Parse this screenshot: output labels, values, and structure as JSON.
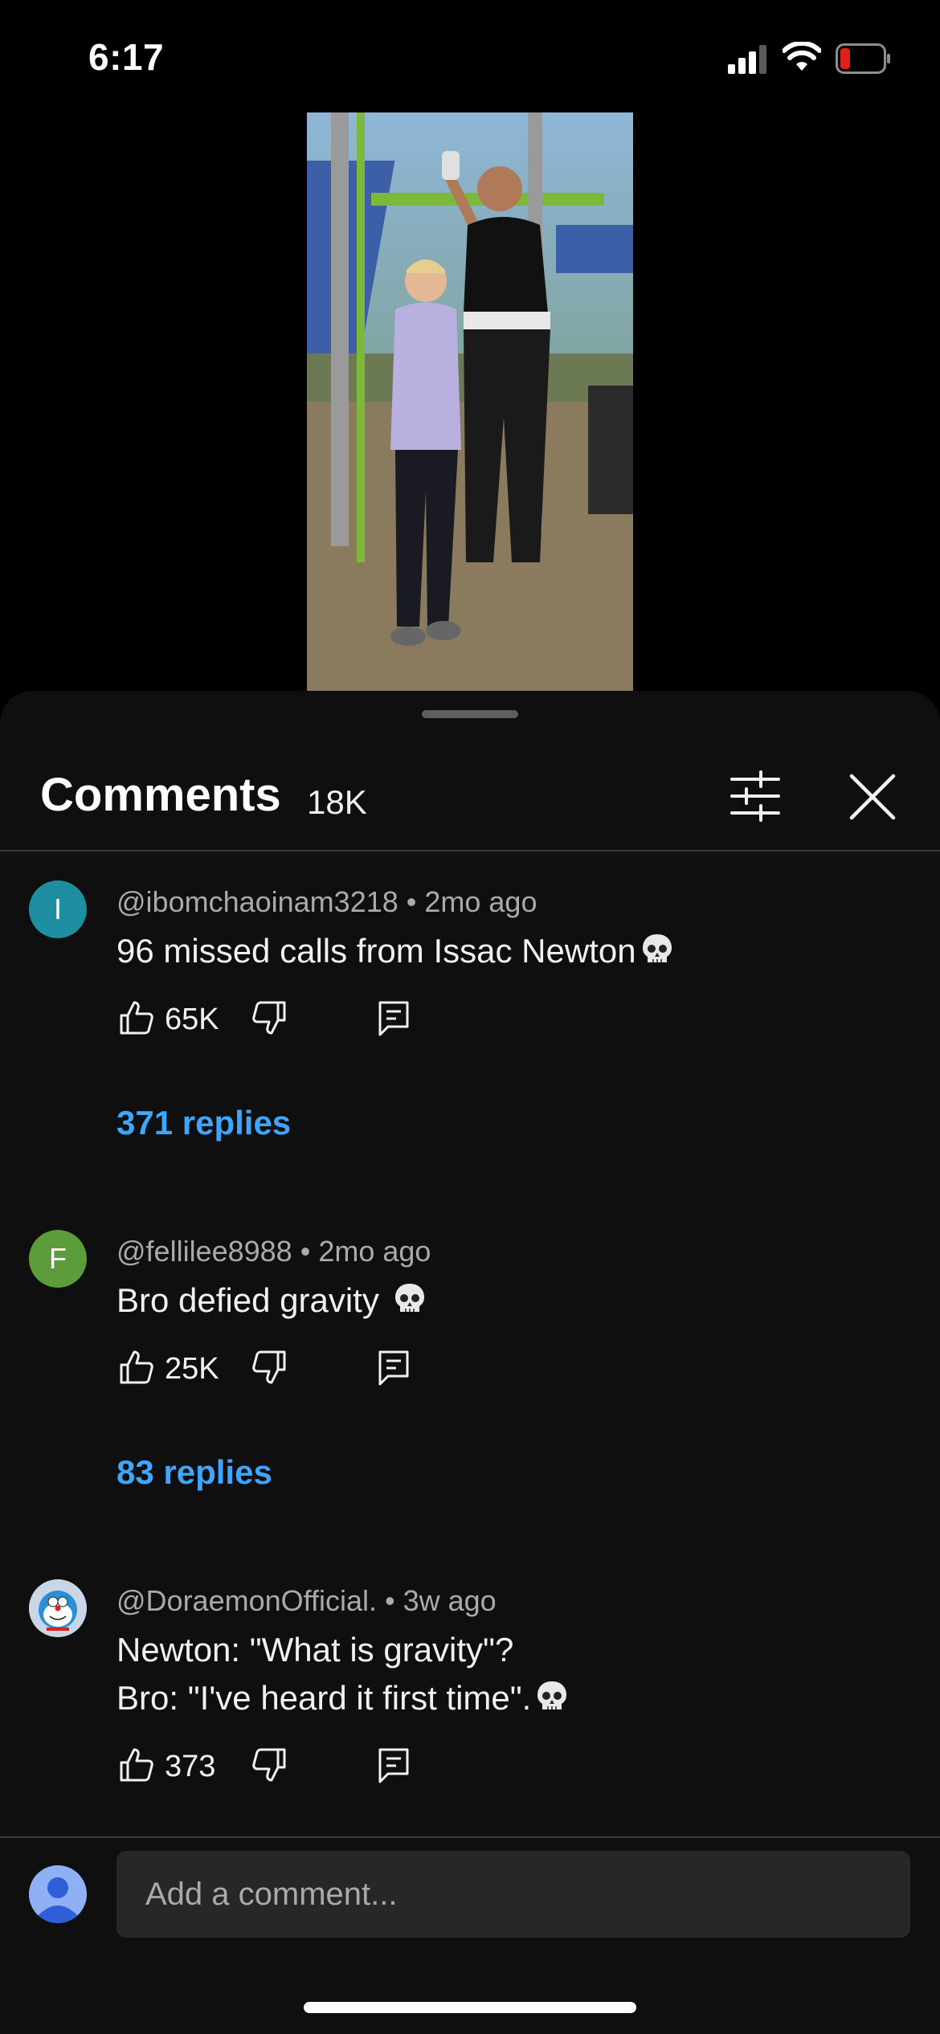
{
  "status_bar": {
    "time": "6:17",
    "icons": [
      "cellular-signal-icon",
      "wifi-icon",
      "battery-low-icon"
    ],
    "battery_color": "#e0201b"
  },
  "video": {
    "description_icon": "video-player"
  },
  "comments_panel": {
    "title": "Comments",
    "count": "18K",
    "icons": [
      "filter-sliders-icon",
      "close-icon"
    ],
    "comments": [
      {
        "avatar_letter": "I",
        "avatar_color": "#1e8fa0",
        "author": "@ibomchaoinam3218",
        "separator": "•",
        "time": "2mo ago",
        "text": "96 missed calls from Issac Newton",
        "emoji": "skull-emoji",
        "likes": "65K",
        "replies": "371 replies"
      },
      {
        "avatar_letter": "F",
        "avatar_color": "#5c9c3a",
        "author": "@fellilee8988",
        "separator": "•",
        "time": "2mo ago",
        "text": "Bro defied gravity ",
        "emoji": "skull-emoji",
        "likes": "25K",
        "replies": "83 replies"
      },
      {
        "avatar_letter": "",
        "avatar_color": "#c9d6e6",
        "author": "@DoraemonOfficial.",
        "separator": "•",
        "time": "3w ago",
        "text_line1": "Newton: \"What is gravity\"?",
        "text_line2": "Bro: \"I've heard it first time\".",
        "emoji": "skull-emoji",
        "likes": "373"
      }
    ],
    "composer": {
      "placeholder": "Add a comment..."
    }
  },
  "colors": {
    "background": "#000000",
    "sheet": "#0f0f0f",
    "link": "#3ea6ff",
    "muted_text": "#aaaaaa"
  }
}
